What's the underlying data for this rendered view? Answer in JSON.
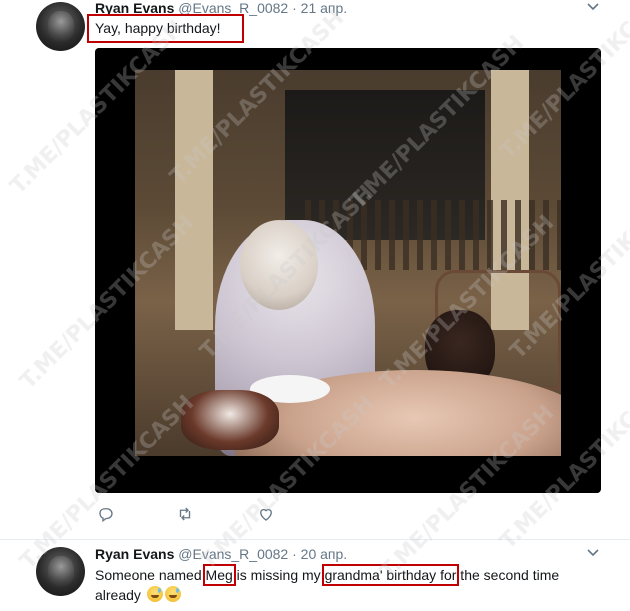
{
  "tweets": [
    {
      "name": "Ryan Evans",
      "handle": "@Evans_R_0082",
      "separator": "·",
      "time": "21 апр.",
      "text": "Yay, happy birthday!"
    },
    {
      "name": "Ryan Evans",
      "handle": "@Evans_R_0082",
      "separator": "·",
      "time": "20 апр.",
      "text_parts": [
        "Someone named ",
        "Meg",
        " is missing my ",
        "grandma' birthday for",
        " the second time already"
      ]
    }
  ],
  "watermark": "T.ME/PLASTIKCASH",
  "icons": {
    "caret": "chevron-down-icon",
    "reply": "reply-icon",
    "retweet": "retweet-icon",
    "like": "heart-icon",
    "emoji": "sweat-smile-emoji"
  },
  "colors": {
    "text": "#14171a",
    "muted": "#657786",
    "highlight_box": "#c00000",
    "divider": "#e6ecf0"
  }
}
